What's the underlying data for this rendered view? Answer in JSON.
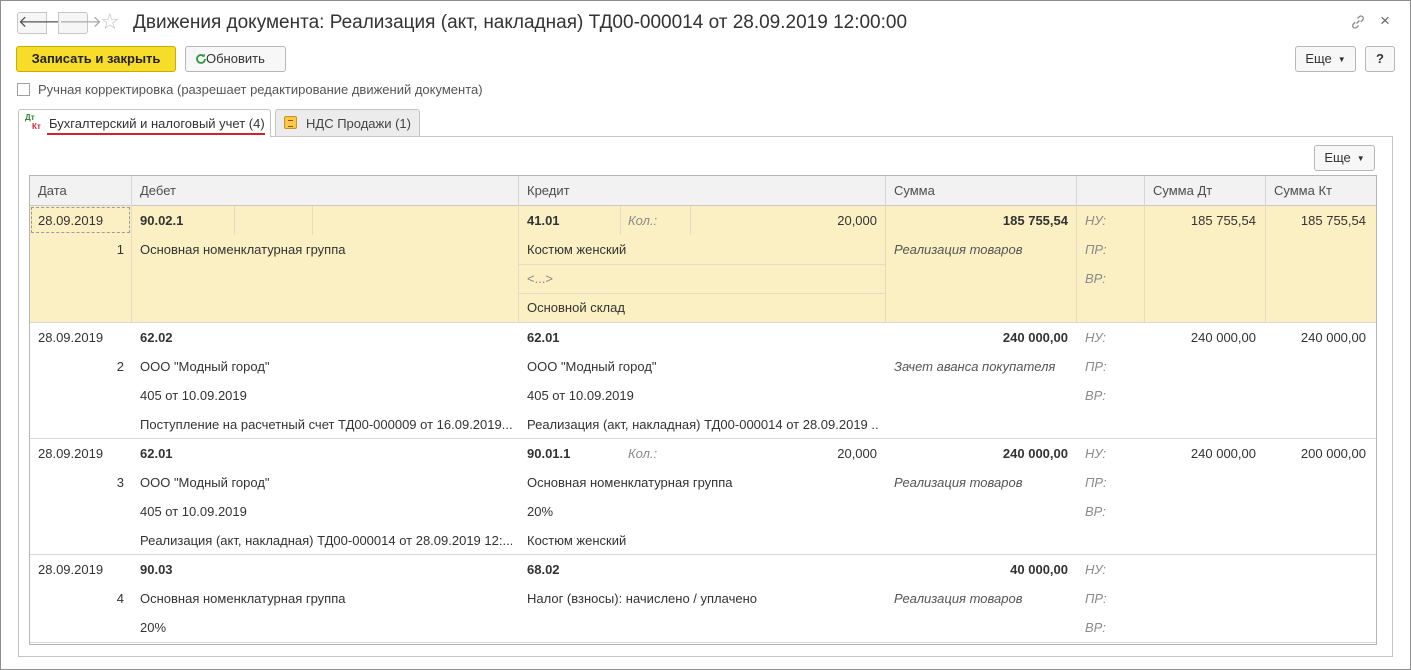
{
  "window": {
    "title": "Движения документа: Реализация (акт, накладная) ТД00-000014 от 28.09.2019 12:00:00",
    "nav_back": "🡐",
    "nav_forward": "🡒",
    "star": "☆",
    "close": "×"
  },
  "toolbar": {
    "save_close": "Записать и закрыть",
    "refresh": "Обновить",
    "more": "Еще",
    "help": "?"
  },
  "manual_edit": {
    "label": "Ручная корректировка (разрешает редактирование движений документа)",
    "checked": false
  },
  "tabs": [
    {
      "label": "Бухгалтерский и налоговый учет (4)",
      "icon": "dt-kt-icon",
      "icon_dt": "Дт",
      "icon_kt": "Кт",
      "active": true
    },
    {
      "label": "НДС Продажи (1)",
      "icon": "vat-sales-icon",
      "active": false
    }
  ],
  "panel": {
    "more": "Еще"
  },
  "table": {
    "columns": [
      "Дата",
      "Дебет",
      "Кредит",
      "Сумма",
      "",
      "Сумма Дт",
      "Сумма Кт"
    ],
    "qty_label": "Кол.:",
    "tax_labels": [
      "НУ:",
      "ПР:",
      "ВР:"
    ],
    "rows": [
      {
        "date": "28.09.2019",
        "n": "1",
        "debit": [
          "90.02.1",
          "Основная номенклатурная группа",
          "",
          ""
        ],
        "credit": [
          "41.01",
          "Костюм женский",
          "<...>",
          "Основной склад"
        ],
        "credit_qty": "20,000",
        "amount": "185 755,54",
        "content": "Реализация товаров",
        "sum_dt": "185 755,54",
        "sum_kt": "185 755,54"
      },
      {
        "date": "28.09.2019",
        "n": "2",
        "debit": [
          "62.02",
          "ООО \"Модный город\"",
          "405 от 10.09.2019",
          "Поступление на расчетный счет ТД00-000009 от 16.09.2019..."
        ],
        "credit": [
          "62.01",
          "ООО \"Модный город\"",
          "405 от 10.09.2019",
          "Реализация (акт, накладная) ТД00-000014 от 28.09.2019 ..."
        ],
        "credit_qty": "",
        "amount": "240 000,00",
        "content": "Зачет аванса покупателя",
        "sum_dt": "240 000,00",
        "sum_kt": "240 000,00"
      },
      {
        "date": "28.09.2019",
        "n": "3",
        "debit": [
          "62.01",
          "ООО \"Модный город\"",
          "405 от 10.09.2019",
          "Реализация (акт, накладная) ТД00-000014 от 28.09.2019 12:..."
        ],
        "credit": [
          "90.01.1",
          "Основная номенклатурная группа",
          "20%",
          "Костюм женский"
        ],
        "credit_qty": "20,000",
        "amount": "240 000,00",
        "content": "Реализация товаров",
        "sum_dt": "240 000,00",
        "sum_kt": "200 000,00"
      },
      {
        "date": "28.09.2019",
        "n": "4",
        "debit": [
          "90.03",
          "Основная номенклатурная группа",
          "20%",
          ""
        ],
        "credit": [
          "68.02",
          "Налог (взносы): начислено / уплачено",
          "",
          ""
        ],
        "credit_qty": "",
        "amount": "40 000,00",
        "content": "Реализация товаров",
        "sum_dt": "",
        "sum_kt": ""
      }
    ]
  },
  "colors": {
    "accent_button": "#f8dc2a",
    "selected_row": "#fbf0c3",
    "tab_underline": "#d0232a"
  }
}
